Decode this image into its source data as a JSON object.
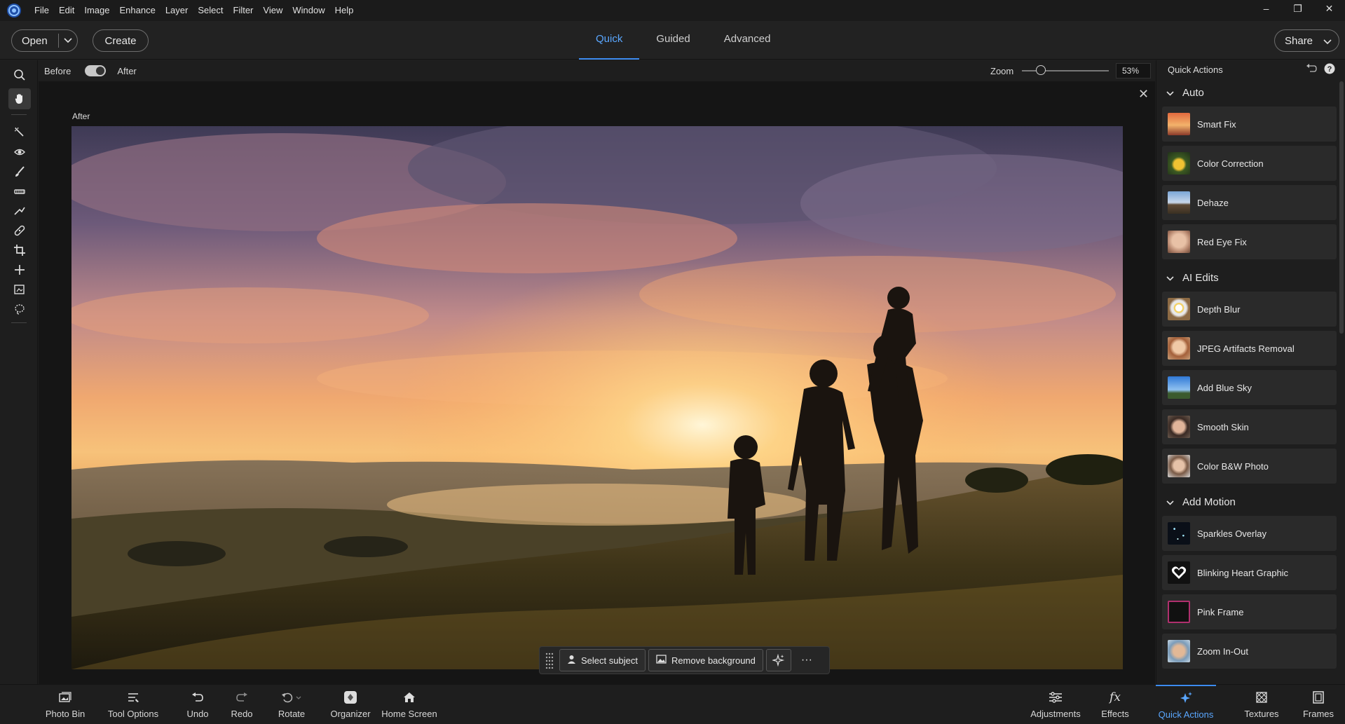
{
  "menubar": {
    "items": [
      "File",
      "Edit",
      "Image",
      "Enhance",
      "Layer",
      "Select",
      "Filter",
      "View",
      "Window",
      "Help"
    ],
    "window_controls": {
      "minimize": "–",
      "restore": "❐",
      "close": "✕"
    }
  },
  "topbar": {
    "open_label": "Open",
    "create_label": "Create",
    "tabs": [
      "Quick",
      "Guided",
      "Advanced"
    ],
    "active_tab": "Quick",
    "share_label": "Share"
  },
  "canvas": {
    "before_label": "Before",
    "after_label": "After",
    "zoom_label": "Zoom",
    "zoom_value": "53%",
    "zoom_level": 0.53,
    "image_title": "After",
    "close_glyph": "✕"
  },
  "float_bar": {
    "select_subject": "Select subject",
    "remove_background": "Remove background",
    "more_glyph": "···"
  },
  "panel": {
    "title": "Quick Actions",
    "sections": [
      {
        "title": "Auto",
        "items": [
          "Smart Fix",
          "Color Correction",
          "Dehaze",
          "Red Eye Fix"
        ]
      },
      {
        "title": "AI Edits",
        "items": [
          "Depth Blur",
          "JPEG Artifacts Removal",
          "Add Blue Sky",
          "Smooth Skin",
          "Color B&W Photo"
        ]
      },
      {
        "title": "Add Motion",
        "items": [
          "Sparkles Overlay",
          "Blinking Heart Graphic",
          "Pink Frame",
          "Zoom In-Out"
        ]
      }
    ]
  },
  "bottombar": {
    "left": [
      "Photo Bin",
      "Tool Options",
      "Undo",
      "Redo",
      "Rotate",
      "Organizer",
      "Home Screen"
    ],
    "right": [
      "Adjustments",
      "Effects",
      "Quick Actions",
      "Textures",
      "Frames"
    ],
    "active": "Quick Actions"
  },
  "colors": {
    "accent": "#3d8cf0",
    "accent_text": "#5aa7ff",
    "background": "#1e1e1e",
    "canvas_bg": "#151515"
  }
}
